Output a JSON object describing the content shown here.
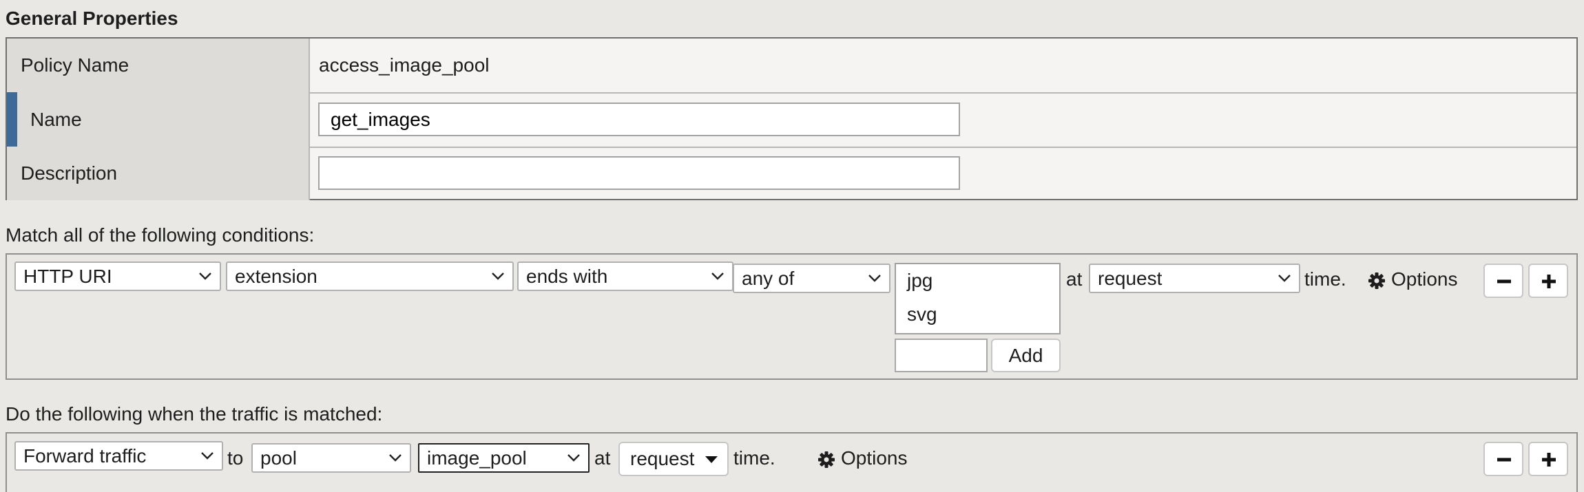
{
  "general": {
    "title": "General Properties",
    "policy_name_label": "Policy Name",
    "policy_name_value": "access_image_pool",
    "name_label": "Name",
    "name_value": "get_images",
    "description_label": "Description",
    "description_value": ""
  },
  "conditions": {
    "heading": "Match all of the following conditions:",
    "operand": "HTTP URI",
    "selector": "extension",
    "operator": "ends with",
    "quantifier": "any of",
    "values": [
      "jpg",
      "svg"
    ],
    "new_value": "",
    "add_label": "Add",
    "at_label": "at",
    "event": "request",
    "time_label": "time.",
    "options_label": "Options"
  },
  "actions": {
    "heading": "Do the following when the traffic is matched:",
    "action": "Forward traffic",
    "to_label": "to",
    "target_type": "pool",
    "target": "image_pool",
    "at_label": "at",
    "event": "request",
    "time_label": "time.",
    "options_label": "Options"
  }
}
